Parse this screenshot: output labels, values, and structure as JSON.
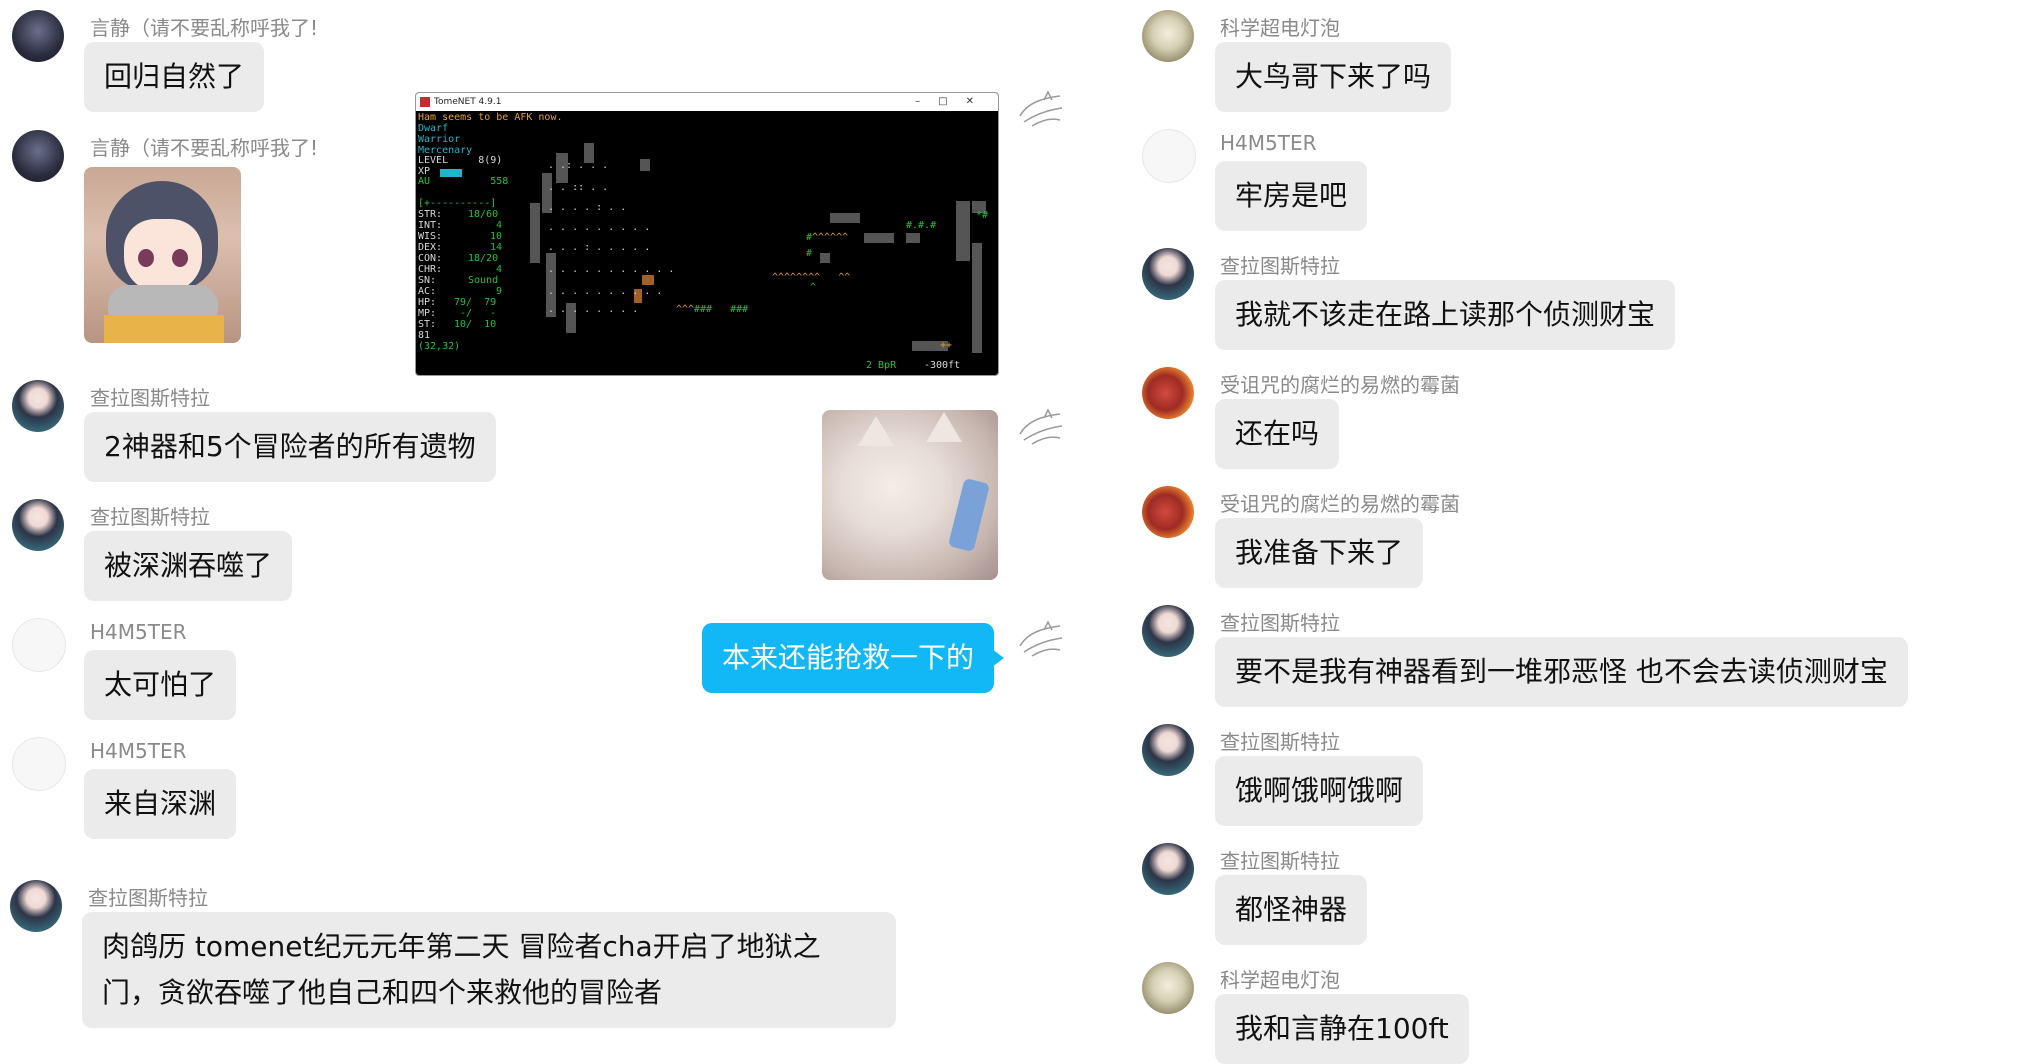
{
  "left_messages": [
    {
      "sender": "言静（请不要乱称呼我了!",
      "avatar": "dark-portrait-avatar",
      "text": "回归自然了"
    },
    {
      "sender": "言静（请不要乱称呼我了!",
      "avatar": "dark-portrait-avatar",
      "sticker": "anime-girl-scarf-sticker"
    },
    {
      "sender": "查拉图斯特拉",
      "avatar": "teal-hair-avatar",
      "text": "2神器和5个冒险者的所有遗物"
    },
    {
      "sender": "查拉图斯特拉",
      "avatar": "teal-hair-avatar",
      "text": "被深渊吞噬了"
    },
    {
      "sender": "H4M5TER",
      "avatar": "sketch-avatar",
      "text": "太可怕了"
    },
    {
      "sender": "H4M5TER",
      "avatar": "sketch-avatar",
      "text": "来自深渊"
    },
    {
      "sender": "查拉图斯特拉",
      "avatar": "teal-hair-avatar",
      "text": "肉鸽历 tomenet纪元元年第二天 冒险者cha开启了地狱之门，贪欲吞噬了他自己和四个来救他的冒险者"
    }
  ],
  "self_messages": {
    "avatar": "sketch-dragon-avatar",
    "terminal": {
      "title": "TomeNET 4.9.1",
      "status": "Ham seems to be AFK now.",
      "race": "Dwarf",
      "class": "Warrior",
      "title_line": "Mercenary",
      "level": "LEVEL     8(9)",
      "xp": "XP",
      "au": "AU          558",
      "divider": "[+----------]",
      "stats": [
        {
          "label": "STR:",
          "value": "18/60"
        },
        {
          "label": "INT:",
          "value": "4"
        },
        {
          "label": "WIS:",
          "value": "10"
        },
        {
          "label": "DEX:",
          "value": "14"
        },
        {
          "label": "CON:",
          "value": "18/20"
        },
        {
          "label": "CHR:",
          "value": "4"
        },
        {
          "label": "SN:",
          "value": "Sound"
        },
        {
          "label": "AC:",
          "value": "9"
        },
        {
          "label": "HP:",
          "value": "79/  79"
        },
        {
          "label": "MP:",
          "value": "-/   -"
        },
        {
          "label": "ST:",
          "value": "10/  10"
        }
      ],
      "extra_line": "81",
      "coords": "(32,32)",
      "bpr": "2 BpR",
      "depth": "-300ft"
    },
    "cat_sticker": "cat-phone-sticker",
    "text": "本来还能抢救一下的"
  },
  "right_messages": [
    {
      "sender": "科学超电灯泡",
      "avatar": "bulb-avatar",
      "text": "大鸟哥下来了吗"
    },
    {
      "sender": "H4M5TER",
      "avatar": "sketch-avatar",
      "text": "牢房是吧"
    },
    {
      "sender": "查拉图斯特拉",
      "avatar": "teal-hair-avatar",
      "text": "我就不该走在路上读那个侦测财宝"
    },
    {
      "sender": "受诅咒的腐烂的易燃的霉菌",
      "avatar": "red-demon-avatar",
      "text": "还在吗"
    },
    {
      "sender": "受诅咒的腐烂的易燃的霉菌",
      "avatar": "red-demon-avatar",
      "text": "我准备下来了"
    },
    {
      "sender": "查拉图斯特拉",
      "avatar": "teal-hair-avatar",
      "text": "要不是我有神器看到一堆邪恶怪 也不会去读侦测财宝"
    },
    {
      "sender": "查拉图斯特拉",
      "avatar": "teal-hair-avatar",
      "text": "饿啊饿啊饿啊"
    },
    {
      "sender": "查拉图斯特拉",
      "avatar": "teal-hair-avatar",
      "text": "都怪神器"
    },
    {
      "sender": "科学超电灯泡",
      "avatar": "bulb-avatar",
      "text": "我和言静在100ft"
    }
  ],
  "colors": {
    "bubble_gray": "#ebebeb",
    "bubble_blue": "#12b7f5",
    "name_gray": "#8a8a8a"
  }
}
